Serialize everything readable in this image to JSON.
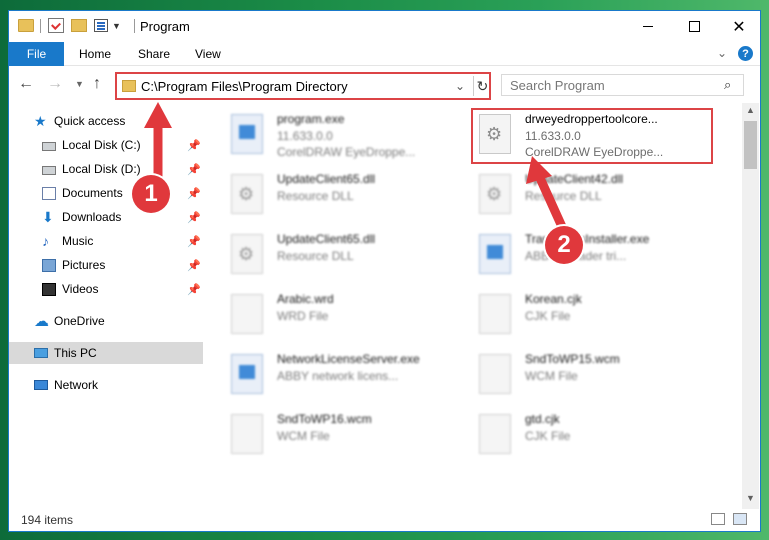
{
  "window": {
    "title": "Program",
    "close_glyph": "✕"
  },
  "ribbon": {
    "tabs": [
      "File",
      "Home",
      "Share",
      "View"
    ]
  },
  "address": {
    "path": "C:\\Program Files\\Program Directory",
    "search_placeholder": "Search Program"
  },
  "sidebar": {
    "items": [
      {
        "label": "Quick access",
        "icon": "star-icon",
        "pinned": false
      },
      {
        "label": "Local Disk (C:)",
        "icon": "drive-icon",
        "pinned": true
      },
      {
        "label": "Local Disk (D:)",
        "icon": "drive-icon",
        "pinned": true
      },
      {
        "label": "Documents",
        "icon": "documents-icon",
        "pinned": true
      },
      {
        "label": "Downloads",
        "icon": "download-icon",
        "pinned": true
      },
      {
        "label": "Music",
        "icon": "music-icon",
        "pinned": true
      },
      {
        "label": "Pictures",
        "icon": "pictures-icon",
        "pinned": true
      },
      {
        "label": "Videos",
        "icon": "videos-icon",
        "pinned": true
      },
      {
        "label": "OneDrive",
        "icon": "onedrive-icon",
        "pinned": false
      },
      {
        "label": "This PC",
        "icon": "computer-icon",
        "pinned": false,
        "selected": true
      },
      {
        "label": "Network",
        "icon": "network-icon",
        "pinned": false
      }
    ]
  },
  "files": [
    {
      "name": "program.exe",
      "line2": "11.633.0.0",
      "line3": "CorelDRAW EyeDroppe...",
      "type": "exe"
    },
    {
      "name": "drweyedroppertoolcore...",
      "line2": "11.633.0.0",
      "line3": "CorelDRAW EyeDroppe...",
      "type": "dll"
    },
    {
      "name": "UpdateClient65.dll",
      "line2": "Resource DLL",
      "line3": "",
      "type": "dll"
    },
    {
      "name": "UpdateClient42.dll",
      "line2": "Resource DLL",
      "line3": "",
      "type": "dll"
    },
    {
      "name": "UpdateClient65.dll",
      "line2": "Resource DLL",
      "line3": "",
      "type": "dll"
    },
    {
      "name": "TransformsInstaller.exe",
      "line2": "ABBYY reader tri...",
      "line3": "",
      "type": "exe"
    },
    {
      "name": "Arabic.wrd",
      "line2": "WRD File",
      "line3": "",
      "type": "file"
    },
    {
      "name": "Korean.cjk",
      "line2": "CJK File",
      "line3": "",
      "type": "file"
    },
    {
      "name": "NetworkLicenseServer.exe",
      "line2": "ABBY network licens...",
      "line3": "",
      "type": "exe"
    },
    {
      "name": "SndToWP15.wcm",
      "line2": "WCM File",
      "line3": "",
      "type": "file"
    },
    {
      "name": "SndToWP16.wcm",
      "line2": "WCM File",
      "line3": "",
      "type": "file"
    },
    {
      "name": "gtd.cjk",
      "line2": "CJK File",
      "line3": "",
      "type": "file"
    }
  ],
  "status": {
    "item_count": "194 items"
  },
  "callouts": [
    "1",
    "2"
  ],
  "colors": {
    "accent": "#1979ca",
    "highlight_red": "#dc4446"
  }
}
